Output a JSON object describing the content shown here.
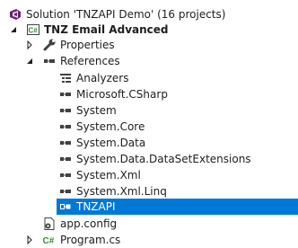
{
  "solution_explorer": {
    "items": [
      {
        "label": "Solution 'TNZAPI Demo' (16 projects)",
        "icon": "solution-icon",
        "expander": "none",
        "level": 0
      },
      {
        "label": "TNZ Email Advanced",
        "icon": "csharp-project-icon",
        "expander": "expanded",
        "level": 0,
        "bold": true
      },
      {
        "label": "Properties",
        "icon": "wrench-icon",
        "expander": "collapsed",
        "level": 1
      },
      {
        "label": "References",
        "icon": "references-icon",
        "expander": "expanded",
        "level": 1
      },
      {
        "label": "Analyzers",
        "icon": "analyzers-icon",
        "expander": "none",
        "level": 2
      },
      {
        "label": "Microsoft.CSharp",
        "icon": "assembly-reference-icon",
        "expander": "none",
        "level": 2
      },
      {
        "label": "System",
        "icon": "assembly-reference-icon",
        "expander": "none",
        "level": 2
      },
      {
        "label": "System.Core",
        "icon": "assembly-reference-icon",
        "expander": "none",
        "level": 2
      },
      {
        "label": "System.Data",
        "icon": "assembly-reference-icon",
        "expander": "none",
        "level": 2
      },
      {
        "label": "System.Data.DataSetExtensions",
        "icon": "assembly-reference-icon",
        "expander": "none",
        "level": 2
      },
      {
        "label": "System.Xml",
        "icon": "assembly-reference-icon",
        "expander": "none",
        "level": 2
      },
      {
        "label": "System.Xml.Linq",
        "icon": "assembly-reference-icon",
        "expander": "none",
        "level": 2
      },
      {
        "label": "TNZAPI",
        "icon": "project-reference-icon",
        "expander": "none",
        "level": 2,
        "selected": true
      },
      {
        "label": "app.config",
        "icon": "config-file-icon",
        "expander": "none",
        "level": 1
      },
      {
        "label": "Program.cs",
        "icon": "csharp-file-icon",
        "expander": "collapsed",
        "level": 1
      }
    ]
  },
  "colors": {
    "selection": "#0078d7",
    "text": "#1e1e1e",
    "csharp_green": "#388a34"
  }
}
